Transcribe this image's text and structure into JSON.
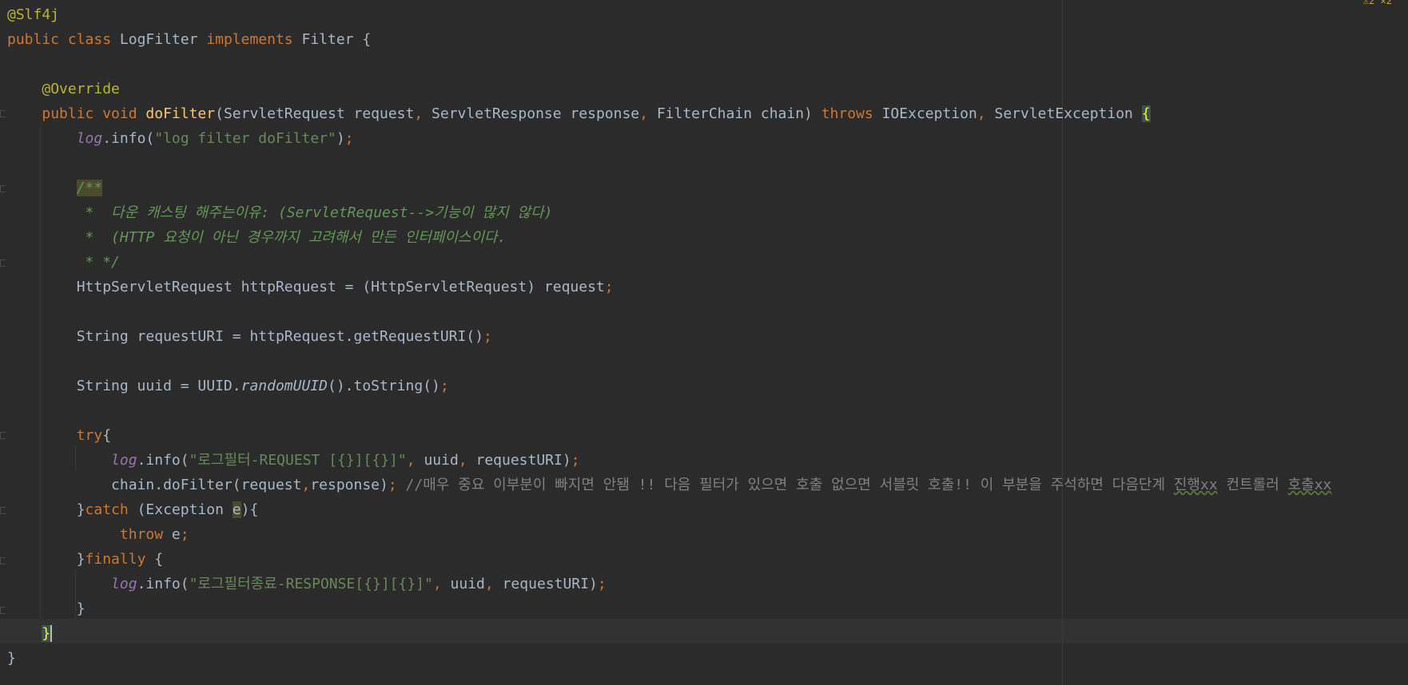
{
  "editor": {
    "corner_hint": "⚠2 ✕2",
    "lines": [
      [
        {
          "t": "@Slf4j",
          "c": "ann"
        }
      ],
      [
        {
          "t": "public class ",
          "c": "kw"
        },
        {
          "t": "LogFilter "
        },
        {
          "t": "implements ",
          "c": "kw"
        },
        {
          "t": "Filter {"
        }
      ],
      [],
      [
        {
          "t": "    "
        },
        {
          "t": "@Override",
          "c": "ann"
        }
      ],
      [
        {
          "t": "    "
        },
        {
          "t": "public void ",
          "c": "kw"
        },
        {
          "t": "doFilter",
          "c": "fn"
        },
        {
          "t": "(ServletRequest request"
        },
        {
          "t": ", ",
          "c": "kw"
        },
        {
          "t": "ServletResponse response"
        },
        {
          "t": ", ",
          "c": "kw"
        },
        {
          "t": "FilterChain chain) "
        },
        {
          "t": "throws ",
          "c": "kw"
        },
        {
          "t": "IOException"
        },
        {
          "t": ", ",
          "c": "kw"
        },
        {
          "t": "ServletException "
        },
        {
          "t": "{",
          "c": "brace-hl"
        }
      ],
      [
        {
          "t": "        "
        },
        {
          "t": "log",
          "c": "field"
        },
        {
          "t": ".info("
        },
        {
          "t": "\"log filter doFilter\"",
          "c": "str"
        },
        {
          "t": ")"
        },
        {
          "t": ";",
          "c": "kw"
        }
      ],
      [],
      [
        {
          "t": "        "
        },
        {
          "t": "/**",
          "c": "doc doc-hl"
        }
      ],
      [
        {
          "t": "         *  다운 캐스팅 해주는이유: (ServletRequest-->기능이 많지 않다)",
          "c": "doc"
        }
      ],
      [
        {
          "t": "         *  (HTTP 요청이 아닌 경우까지 고려해서 만든 인터페이스이다.",
          "c": "doc"
        }
      ],
      [
        {
          "t": "         * */",
          "c": "doc"
        }
      ],
      [
        {
          "t": "        HttpServletRequest httpRequest = (HttpServletRequest) request"
        },
        {
          "t": ";",
          "c": "kw"
        }
      ],
      [],
      [
        {
          "t": "        String requestURI = httpRequest.getRequestURI()"
        },
        {
          "t": ";",
          "c": "kw"
        }
      ],
      [],
      [
        {
          "t": "        String uuid = UUID."
        },
        {
          "t": "randomUUID",
          "c": "static-it"
        },
        {
          "t": "().toString()"
        },
        {
          "t": ";",
          "c": "kw"
        }
      ],
      [],
      [
        {
          "t": "        "
        },
        {
          "t": "try",
          "c": "kw"
        },
        {
          "t": "{"
        }
      ],
      [
        {
          "t": "            "
        },
        {
          "t": "log",
          "c": "field"
        },
        {
          "t": ".info("
        },
        {
          "t": "\"로그필터-REQUEST [{}][{}]\"",
          "c": "str"
        },
        {
          "t": ", ",
          "c": "kw"
        },
        {
          "t": "uuid"
        },
        {
          "t": ", ",
          "c": "kw"
        },
        {
          "t": "requestURI)"
        },
        {
          "t": ";",
          "c": "kw"
        }
      ],
      [
        {
          "t": "            chain.doFilter(request"
        },
        {
          "t": ",",
          "c": "kw"
        },
        {
          "t": "response)"
        },
        {
          "t": "; ",
          "c": "kw"
        },
        {
          "t": "//매우 중요 이부분이 빠지면 안됌 !! 다음 필터가 있으면 호출 없으면 서블릿 호출!! 이 부분을 주석하면 다음단계 ",
          "c": "cmt"
        },
        {
          "t": "진행xx",
          "c": "cmt typo"
        },
        {
          "t": " 컨트롤러 ",
          "c": "cmt"
        },
        {
          "t": "호출xx",
          "c": "cmt typo"
        }
      ],
      [
        {
          "t": "        }"
        },
        {
          "t": "catch ",
          "c": "kw"
        },
        {
          "t": "(Exception "
        },
        {
          "t": "e",
          "c": "var-hl"
        },
        {
          "t": "){"
        }
      ],
      [
        {
          "t": "             "
        },
        {
          "t": "throw ",
          "c": "kw"
        },
        {
          "t": "e"
        },
        {
          "t": ";",
          "c": "kw"
        }
      ],
      [
        {
          "t": "        }"
        },
        {
          "t": "finally ",
          "c": "kw"
        },
        {
          "t": "{"
        }
      ],
      [
        {
          "t": "            "
        },
        {
          "t": "log",
          "c": "field"
        },
        {
          "t": ".info("
        },
        {
          "t": "\"로그필터종료-RESPONSE[{}][{}]\"",
          "c": "str"
        },
        {
          "t": ", ",
          "c": "kw"
        },
        {
          "t": "uuid"
        },
        {
          "t": ", ",
          "c": "kw"
        },
        {
          "t": "requestURI)"
        },
        {
          "t": ";",
          "c": "kw"
        }
      ],
      [
        {
          "t": "        }"
        }
      ],
      [
        {
          "t": "    "
        },
        {
          "t": "}",
          "c": "caret-brace"
        }
      ],
      [
        {
          "t": "}"
        }
      ]
    ]
  }
}
